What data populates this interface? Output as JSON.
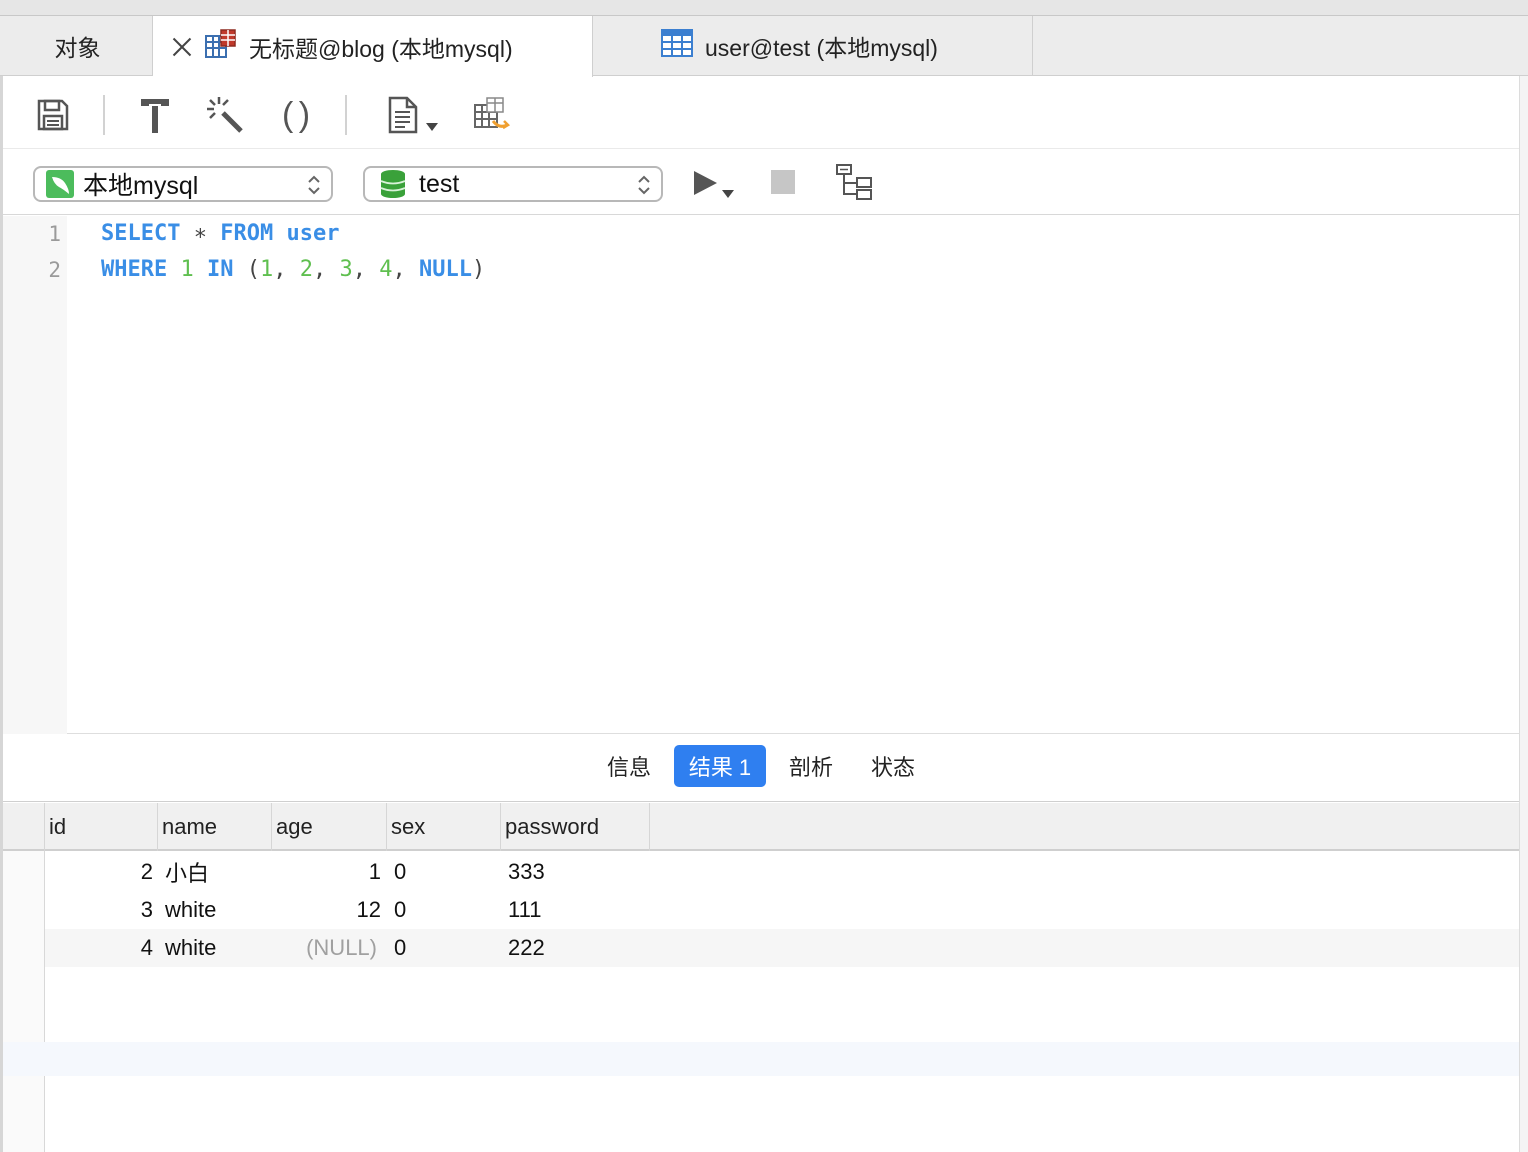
{
  "tabs": {
    "objects": "对象",
    "query_tab": "无标题@blog (本地mysql)",
    "table_tab": "user@test (本地mysql)"
  },
  "toolbar": {
    "save_icon": "save-icon",
    "beautify_icon": "hammer-icon",
    "magic_icon": "magic-wand-icon",
    "paren_icon": "parentheses-icon",
    "paren_glyph": "( )",
    "snippet_icon": "document-icon",
    "export_icon": "grid-export-icon"
  },
  "selectors": {
    "connection": "本地mysql",
    "database": "test"
  },
  "editor": {
    "line_numbers": [
      "1",
      "2"
    ],
    "line1": {
      "select": "SELECT",
      "star": " ∗ ",
      "from": "FROM",
      "table": " user"
    },
    "line2": {
      "where": "WHERE",
      "sp1": " ",
      "one": "1",
      "sp2": " ",
      "in": "IN",
      "open": " (",
      "n1": "1",
      "c1": ", ",
      "n2": "2",
      "c2": ", ",
      "n3": "3",
      "c3": ", ",
      "n4": "4",
      "c4": ", ",
      "null": "NULL",
      "close": ")"
    }
  },
  "result_tabs": {
    "info": "信息",
    "result1": "结果 1",
    "profile": "剖析",
    "status": "状态"
  },
  "grid": {
    "columns": [
      "id",
      "name",
      "age",
      "sex",
      "password"
    ],
    "rows": [
      {
        "id": "2",
        "name": "小白",
        "age": "1",
        "sex": "0",
        "password": "333"
      },
      {
        "id": "3",
        "name": "white",
        "age": "12",
        "sex": "0",
        "password": "111"
      },
      {
        "id": "4",
        "name": "white",
        "age": "(NULL)",
        "sex": "0",
        "password": "222"
      }
    ]
  },
  "colors": {
    "keyword": "#3a8ee6",
    "number": "#5fbf4f",
    "active_tab": "#2f7ff0"
  }
}
